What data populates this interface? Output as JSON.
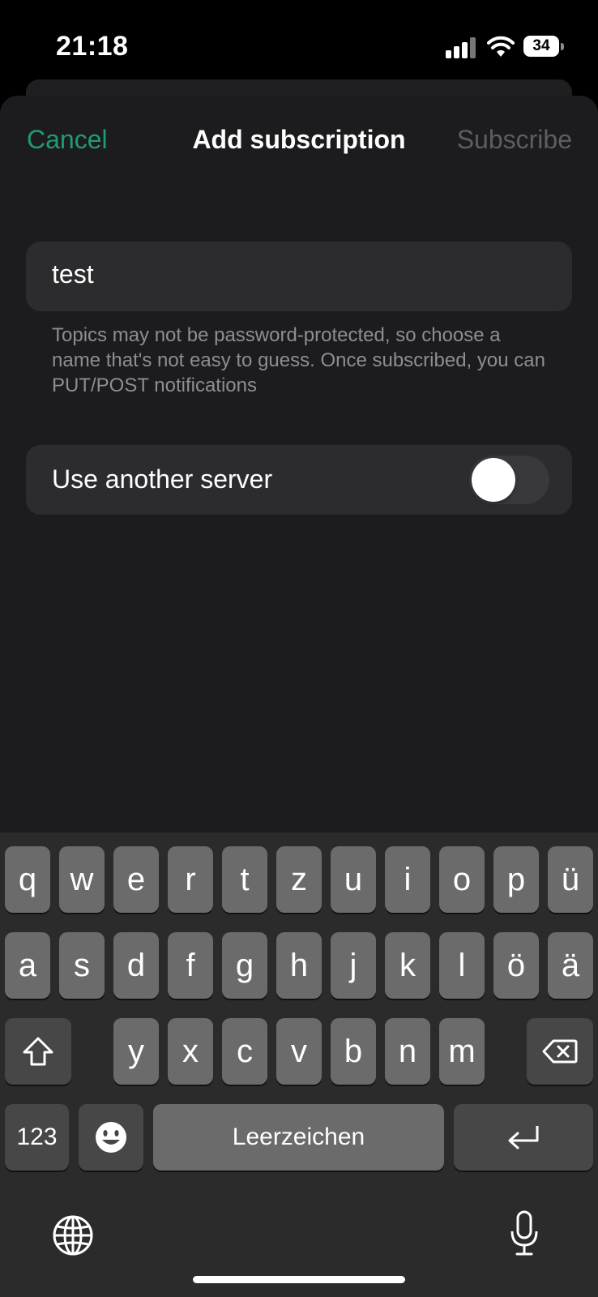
{
  "status_bar": {
    "time": "21:18",
    "battery": "34"
  },
  "nav": {
    "cancel": "Cancel",
    "title": "Add subscription",
    "subscribe": "Subscribe"
  },
  "colors": {
    "accent": "#1f9a78",
    "disabled": "#5d5d62",
    "sheet": "#1c1c1e",
    "field": "#2c2c2e"
  },
  "topic": {
    "value": "test"
  },
  "hint": "Topics may not be password-protected, so choose a name that's not easy to guess. Once subscribed, you can PUT/POST notifications",
  "server": {
    "label": "Use another server",
    "enabled": false
  },
  "keyboard": {
    "row1": [
      "q",
      "w",
      "e",
      "r",
      "t",
      "z",
      "u",
      "i",
      "o",
      "p",
      "ü"
    ],
    "row2": [
      "a",
      "s",
      "d",
      "f",
      "g",
      "h",
      "j",
      "k",
      "l",
      "ö",
      "ä"
    ],
    "row3": [
      "y",
      "x",
      "c",
      "v",
      "b",
      "n",
      "m"
    ],
    "numbers": "123",
    "space": "Leerzeichen",
    "icons": {
      "shift": "shift-icon",
      "delete": "delete-icon",
      "emoji": "emoji-icon",
      "return": "return-icon",
      "globe": "globe-icon",
      "mic": "microphone-icon"
    }
  }
}
